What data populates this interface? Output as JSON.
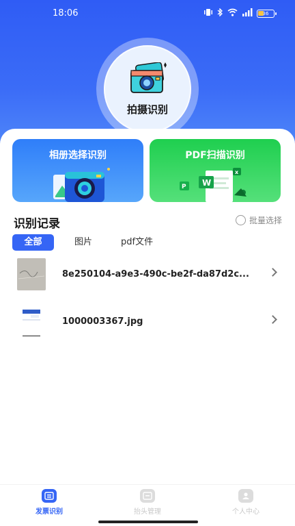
{
  "status_bar": {
    "time": "18:06",
    "battery_level": "36",
    "icons": [
      "vibrate-icon",
      "bluetooth-icon",
      "wifi-icon",
      "signal-icon",
      "battery-icon"
    ]
  },
  "hero": {
    "capture_label": "拍摄识别"
  },
  "cards": {
    "album_title": "相册选择识别",
    "pdf_title": "PDF扫描识别"
  },
  "records_section": {
    "title": "识别记录",
    "batch_select_label": "批量选择"
  },
  "tabs": [
    {
      "label": "全部",
      "active": true
    },
    {
      "label": "图片",
      "active": false
    },
    {
      "label": "pdf文件",
      "active": false
    }
  ],
  "records": [
    {
      "name": "8e250104-a9e3-490c-be2f-da87d2c..."
    },
    {
      "name": "1000003367.jpg"
    }
  ],
  "bottom_nav": [
    {
      "label": "发票识别",
      "active": true
    },
    {
      "label": "抬头管理",
      "active": false
    },
    {
      "label": "个人中心",
      "active": false
    }
  ],
  "colors": {
    "primary": "#3565f5",
    "pdf_green": "#1fcf4f",
    "inactive_nav": "#c8c8c8"
  }
}
